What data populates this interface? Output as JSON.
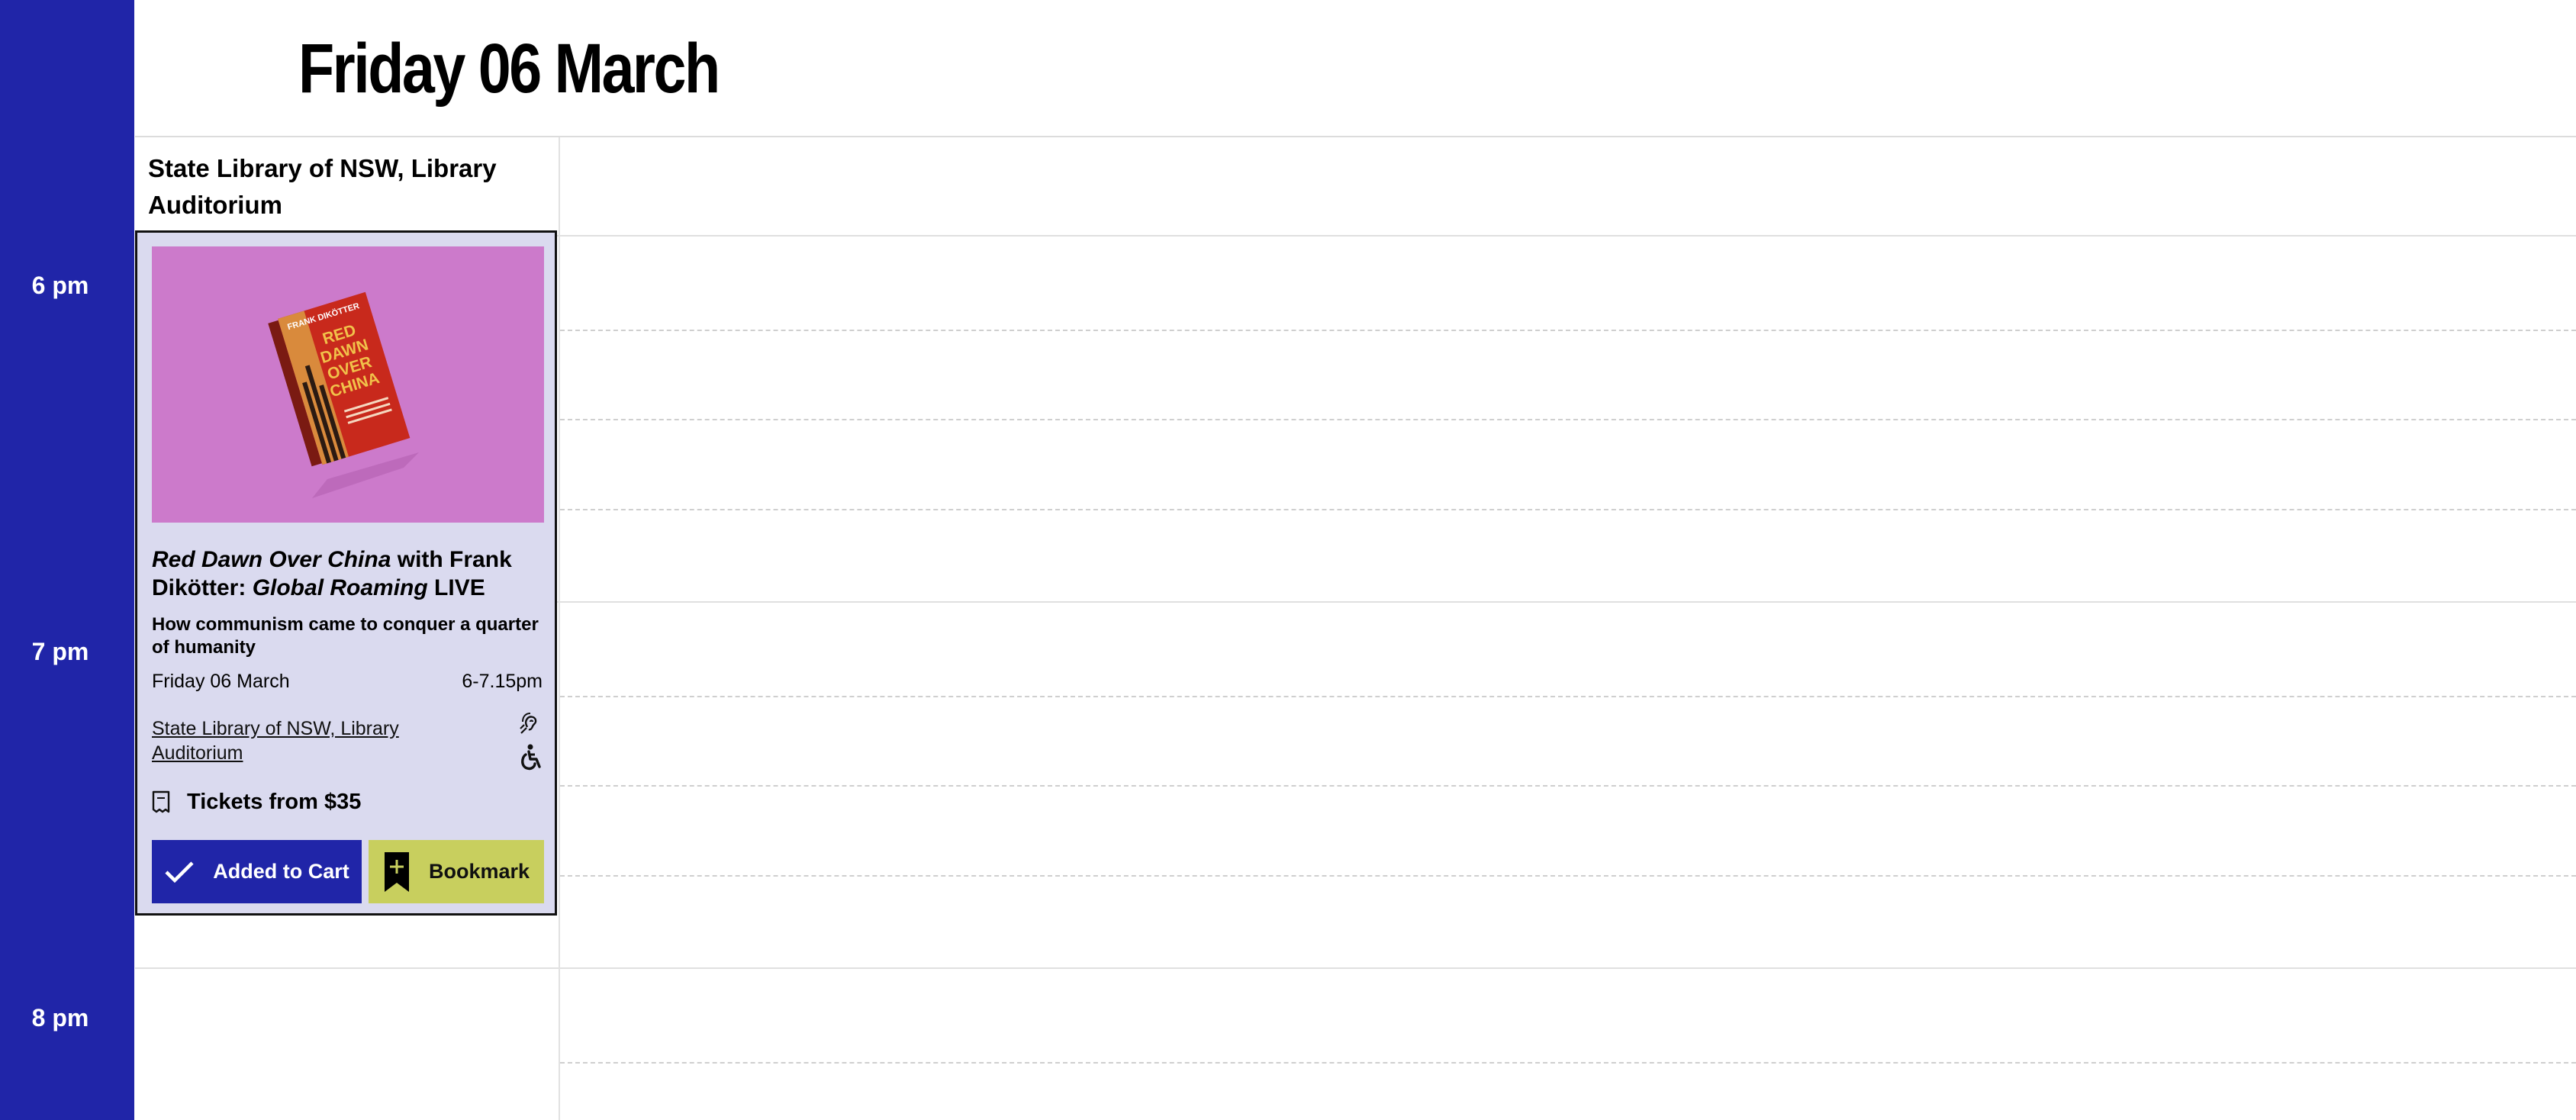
{
  "header": {
    "day_title": "Friday 06 March"
  },
  "time_column": {
    "labels": [
      "6 pm",
      "7 pm",
      "8 pm"
    ]
  },
  "venue": {
    "name": "State Library of NSW, Library Auditorium"
  },
  "event": {
    "image_alt": "Red Dawn Over China book cover",
    "book_cover_text": {
      "author": "FRANK DIKÖTTER",
      "line1": "RED",
      "line2": "DAWN",
      "line3": "OVER",
      "line4": "CHINA"
    },
    "title_italic_1": "Red Dawn Over China",
    "title_plain_1": " with Frank Dikötter: ",
    "title_italic_2": "Global Roaming",
    "title_plain_2": " LIVE",
    "subtitle": "How communism came to conquer a quarter of humanity",
    "date": "Friday 06 March",
    "time": "6-7.15pm",
    "venue_link": "State Library of NSW, Library Auditorium",
    "tickets": "Tickets from $35",
    "cart_button": "Added to Cart",
    "bookmark_button": "Bookmark",
    "icons": [
      "hearing-loop-icon",
      "wheelchair-icon",
      "ticket-icon",
      "checkmark-icon",
      "bookmark-plus-icon"
    ]
  },
  "colors": {
    "sidebar": "#2025a8",
    "card_background": "#dadaef",
    "cart_button": "#2025a8",
    "bookmark_button": "#c8cf5e",
    "image_background": "#cc7acb"
  }
}
